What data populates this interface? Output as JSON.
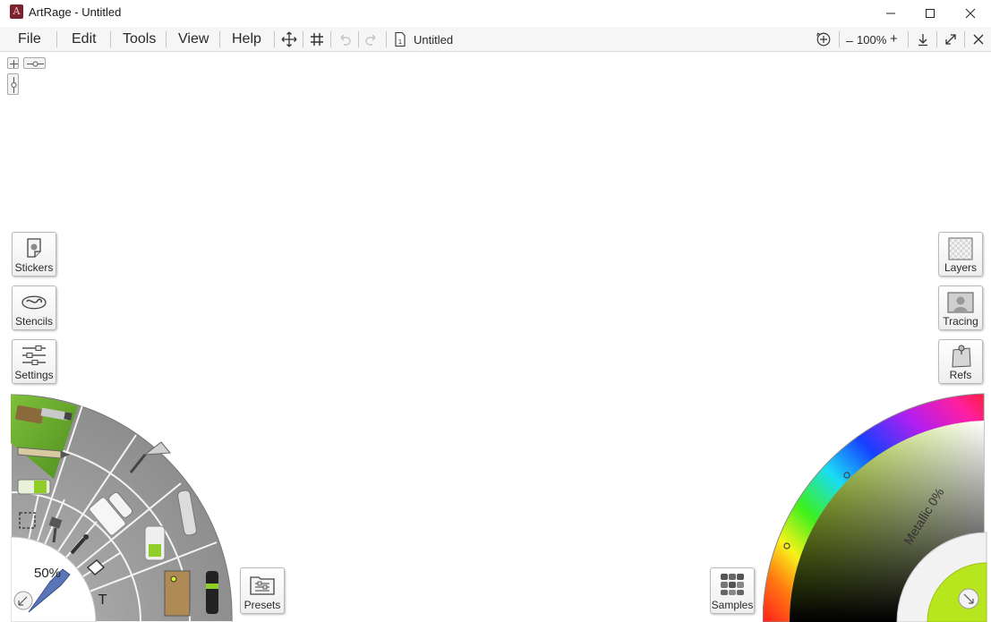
{
  "window": {
    "title": "ArtRage - Untitled",
    "logo_glyph": "A"
  },
  "menu": {
    "items": [
      "File",
      "Edit",
      "Tools",
      "View",
      "Help"
    ]
  },
  "toolbar": {
    "doc_title": "Untitled",
    "zoom": "100%",
    "zoom_minus": "–",
    "zoom_plus": "+"
  },
  "left_panel": {
    "stickers": "Stickers",
    "stencils": "Stencils",
    "settings": "Settings",
    "presets": "Presets"
  },
  "right_panel": {
    "layers": "Layers",
    "tracing": "Tracing",
    "refs": "Refs",
    "samples": "Samples"
  },
  "tools": {
    "brush_size": "50%"
  },
  "color": {
    "metallic": "Metallic 0%",
    "current_color": "#b7e61f",
    "accent": "#8fce28"
  }
}
